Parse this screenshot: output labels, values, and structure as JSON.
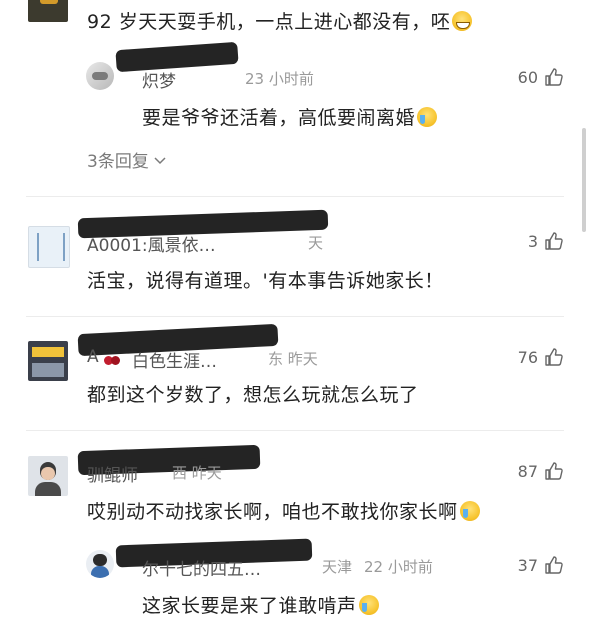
{
  "comments": [
    {
      "text": "92 岁天天耍手机，一点上进心都没有，呸",
      "emoji": "grin",
      "replies": [
        {
          "name": "炽梦",
          "time": "23 小时前",
          "likes": "60",
          "text": "要是爷爷还活着，高低要闹离婚",
          "emoji": "cry"
        }
      ],
      "reply_link": "3条回复"
    },
    {
      "name": "A0001:風景依…",
      "time": "天",
      "likes": "3",
      "text": "活宝，说得有道理。'有本事告诉她家长！"
    },
    {
      "name": "白色生涯…",
      "name_prefix": "A",
      "time": "东 昨天",
      "likes": "76",
      "text": "都到这个岁数了，想怎么玩就怎么玩了"
    },
    {
      "name": "驯鲲师",
      "time": "西 昨天",
      "likes": "87",
      "text": "哎别动不动找家长啊，咱也不敢找你家长啊",
      "emoji": "cry",
      "replies": [
        {
          "name": "尔十七的四五…",
          "location": "天津",
          "time": "22 小时前",
          "likes": "37",
          "text": "这家长要是来了谁敢啃声",
          "emoji": "cry"
        }
      ]
    }
  ],
  "icons": {
    "like": "thumbs-up-icon",
    "chevron": "chevron-down-icon"
  },
  "colors": {
    "text": "#222222",
    "meta": "#9a9a9a",
    "scribble": "#111111"
  }
}
